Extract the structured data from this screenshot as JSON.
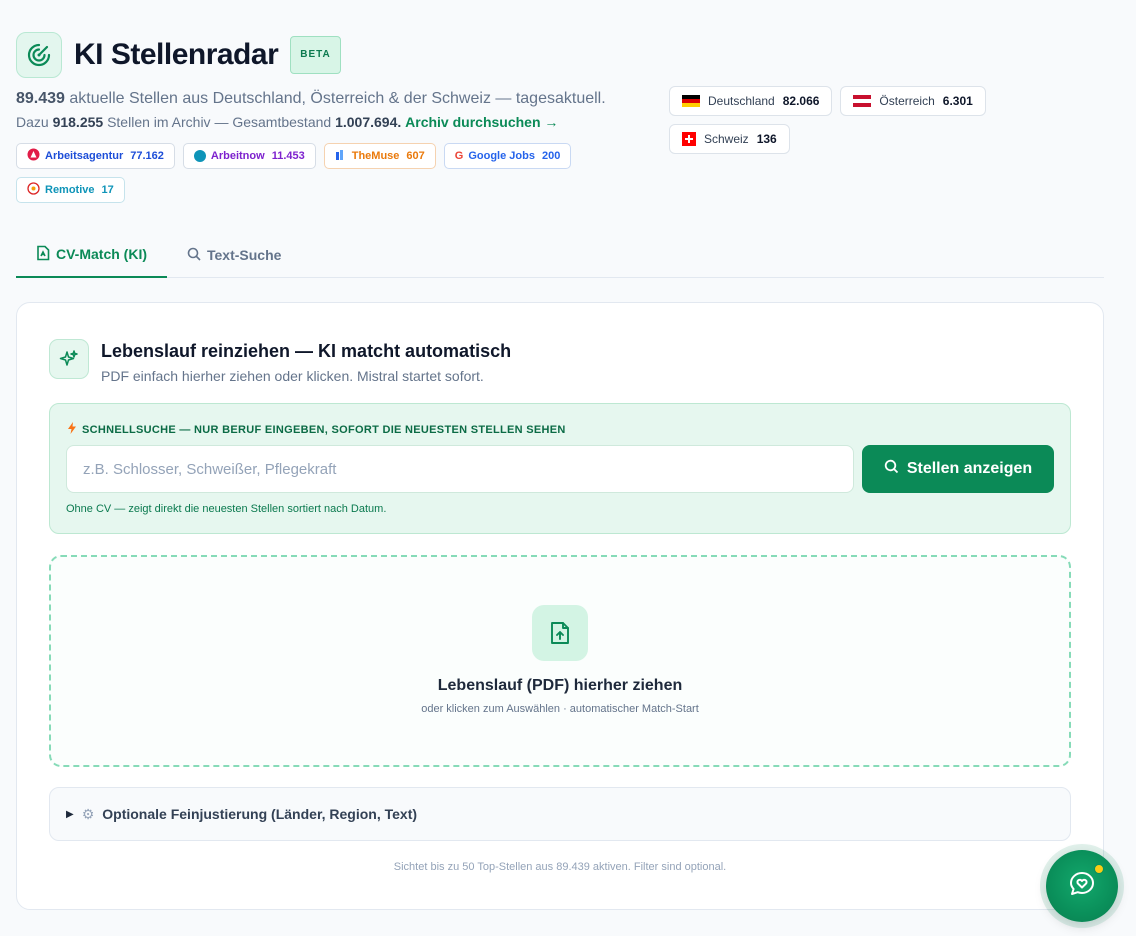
{
  "app": {
    "title": "KI Stellenradar",
    "badge": "BETA"
  },
  "stats": {
    "active_count": "89.439",
    "active_text": "aktuelle Stellen aus Deutschland, Österreich & der Schweiz — tagesaktuell.",
    "archive_prefix": "Dazu",
    "archive_count": "918.255",
    "archive_mid": "Stellen im Archiv — Gesamtbestand",
    "total_count": "1.007.694.",
    "archive_link": "Archiv durchsuchen →"
  },
  "sources": [
    {
      "name": "Arbeitsagentur",
      "count": "77.162",
      "color": "#1d4ed8",
      "icon_color": "#e11d48",
      "icon": "arbeitsagentur-icon",
      "border": "#d6dde6"
    },
    {
      "name": "Arbeitnow",
      "count": "11.453",
      "color": "#7e22ce",
      "icon_color": "#0e94b8",
      "icon": "arbeitnow-icon",
      "border": "#d6dde6"
    },
    {
      "name": "TheMuse",
      "count": "607",
      "color": "#ea7a0c",
      "icon_color": "#2563eb",
      "icon": "themuse-icon",
      "border": "#f5d2b0"
    },
    {
      "name": "Google Jobs",
      "count": "200",
      "color": "#2563eb",
      "icon_color": "#4285f4",
      "icon": "google-icon",
      "border": "#c9d9f3"
    },
    {
      "name": "Remotive",
      "count": "17",
      "color": "#0e94b8",
      "icon_color": "#dc2626",
      "icon": "remotive-icon",
      "border": "#c6e3ec"
    }
  ],
  "countries": [
    {
      "name": "Deutschland",
      "count": "82.066",
      "flag": "de-flag-icon"
    },
    {
      "name": "Österreich",
      "count": "6.301",
      "flag": "at-flag-icon"
    },
    {
      "name": "Schweiz",
      "count": "136",
      "flag": "ch-flag-icon"
    }
  ],
  "tabs": [
    {
      "label": "CV-Match (KI)",
      "icon": "document-icon",
      "active": true
    },
    {
      "label": "Text-Suche",
      "icon": "search-icon",
      "active": false
    }
  ],
  "card": {
    "title": "Lebenslauf reinziehen — KI matcht automatisch",
    "subtitle": "PDF einfach hierher ziehen oder klicken. Mistral startet sofort."
  },
  "quick": {
    "label": "SCHNELLSUCHE — NUR BERUF EINGEBEN, SOFORT DIE NEUESTEN STELLEN SEHEN",
    "placeholder": "z.B. Schlosser, Schweißer, Pflegekraft",
    "button": "Stellen anzeigen",
    "hint": "Ohne CV — zeigt direkt die neuesten Stellen sortiert nach Datum."
  },
  "drop": {
    "title": "Lebenslauf (PDF) hierher ziehen",
    "subtitle": "oder klicken zum Auswählen · automatischer Match-Start"
  },
  "advanced": {
    "label": "Optionale Feinjustierung (Länder, Region, Text)"
  },
  "footer": {
    "text": "Sichtet bis zu 50 Top-Stellen aus 89.439 aktiven. Filter sind optional."
  },
  "colors": {
    "accent": "#0b8a57",
    "accent_light": "#e6f7ef"
  }
}
